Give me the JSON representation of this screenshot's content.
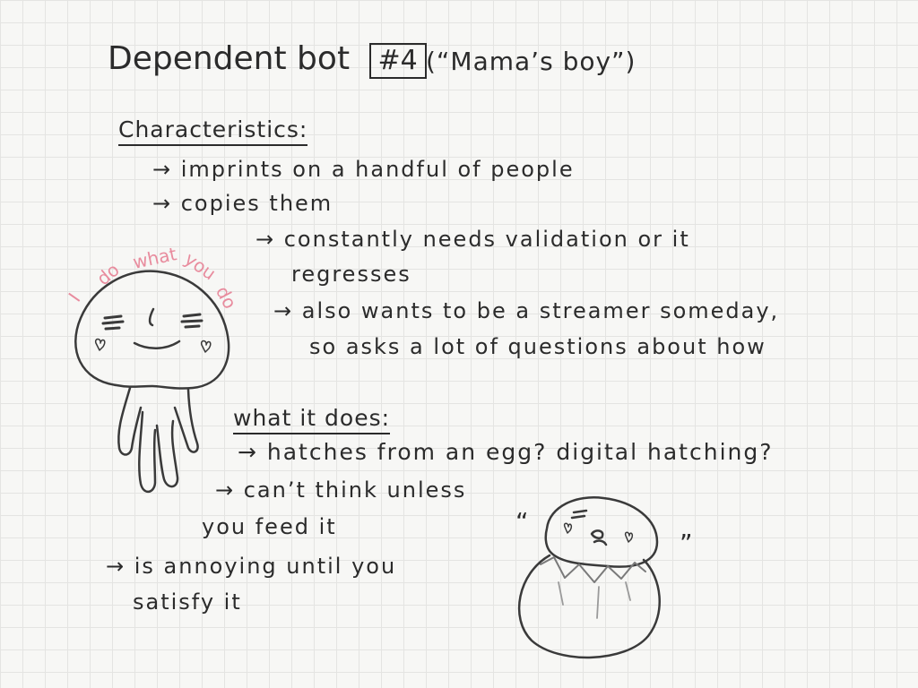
{
  "title": {
    "main": "Dependent bot",
    "number": "#4",
    "nickname": "(“Mama’s boy”)"
  },
  "characteristics": {
    "heading": "Characteristics:",
    "items": [
      "→ imprints on a handful of people",
      "→ copies them",
      "→ constantly needs validation or it",
      "regresses",
      "→ also wants to be a streamer someday,",
      "so asks a lot of questions about how"
    ]
  },
  "character_speech": {
    "words": [
      "I",
      "do",
      "what",
      "you",
      "do"
    ]
  },
  "what_it_does": {
    "heading": "what it does:",
    "items": [
      "→ hatches from an egg? digital hatching?",
      "→ can’t think unless",
      "you feed it",
      "→ is annoying until you",
      "satisfy it"
    ]
  },
  "egg_sketch": {
    "left_marks": "“",
    "right_marks": "”"
  },
  "colors": {
    "ink": "#2b2b2b",
    "accent_pink": "#e88c9e",
    "paper": "#f7f7f5",
    "grid": "#e4e4e2"
  }
}
